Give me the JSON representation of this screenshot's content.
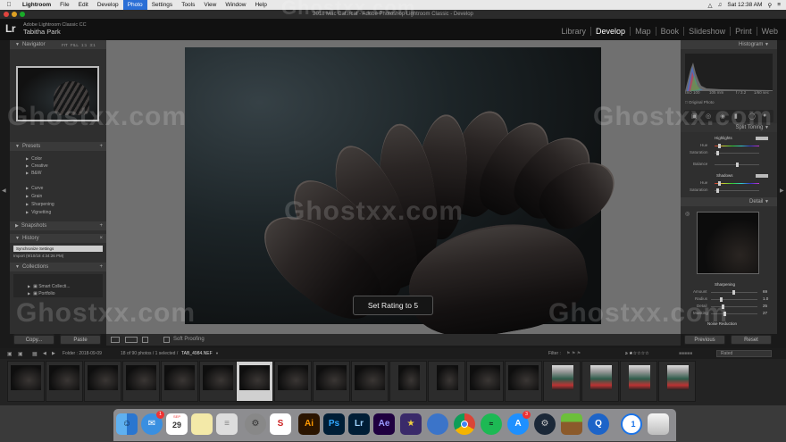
{
  "menubar": {
    "app": "Lightroom",
    "items": [
      "File",
      "Edit",
      "Develop",
      "Photo",
      "Settings",
      "Tools",
      "View",
      "Window",
      "Help"
    ],
    "active": "Photo",
    "clock": "Sat 12:38 AM"
  },
  "window": {
    "title": "2018 Mac Cat.lrcat - Adobe Photoshop Lightroom Classic - Develop"
  },
  "identity": {
    "logo": "Lr",
    "catalog": "Adobe Lightroom Classic CC",
    "user": "Tabitha Park"
  },
  "modules": [
    "Library",
    "Develop",
    "Map",
    "Book",
    "Slideshow",
    "Print",
    "Web"
  ],
  "active_module": "Develop",
  "left_panel": {
    "navigator": {
      "title": "Navigator",
      "zoom": "FIT  FILL  1:1  3:1"
    },
    "presets": {
      "title": "Presets",
      "items": [
        "Color",
        "Creative",
        "B&W",
        "Curve",
        "Grain",
        "Sharpening",
        "Vignetting"
      ]
    },
    "snapshots": {
      "title": "Snapshots"
    },
    "history": {
      "title": "History",
      "items": [
        "Synchronize Settings",
        "Import (9/10/18 4:34:26 PM)"
      ]
    },
    "collections": {
      "title": "Collections",
      "items": [
        "Smart Collecti...",
        "Portfolio"
      ]
    },
    "copy_label": "Copy...",
    "paste_label": "Paste"
  },
  "toast": "Set Rating to 5",
  "toolbar": {
    "soft_proofing": "Soft Proofing"
  },
  "right_panel": {
    "histogram": {
      "title": "Histogram",
      "iso": "ISO 100",
      "focal": "105 mm",
      "aperture": "f / 3.2",
      "shutter": "1/60 sec",
      "original_photo": "Original Photo"
    },
    "split_toning": {
      "title": "Split Toning",
      "highlights": "Highlights",
      "hue": "Hue",
      "saturation": "Saturation",
      "balance": "Balance",
      "shadows": "Shadows"
    },
    "detail": {
      "title": "Detail",
      "sharpening": "Sharpening",
      "amount": "Amount",
      "radius": "Radius",
      "detail": "Detail",
      "masking": "Masking",
      "amount_val": "69",
      "radius_val": "1.0",
      "detail_val": "25",
      "masking_val": "27",
      "noise_reduction": "Noise Reduction"
    },
    "previous_label": "Previous",
    "reset_label": "Reset"
  },
  "filmstrip": {
    "folder": "Folder : 2018-09-09",
    "count": "18 of 90 photos / 1 selected /",
    "selected_file": "TAB_4984.NEF",
    "filter_label": "Filter :",
    "rated": "Rated"
  },
  "dock": {
    "mail_badge": "1",
    "calendar_month": "SEP",
    "calendar_day": "29",
    "appstore_badge": "3",
    "illustrator": "Ai",
    "photoshop": "Ps",
    "lightroom": "Lr",
    "after_effects": "Ae"
  },
  "watermark": "Ghostxx.com"
}
